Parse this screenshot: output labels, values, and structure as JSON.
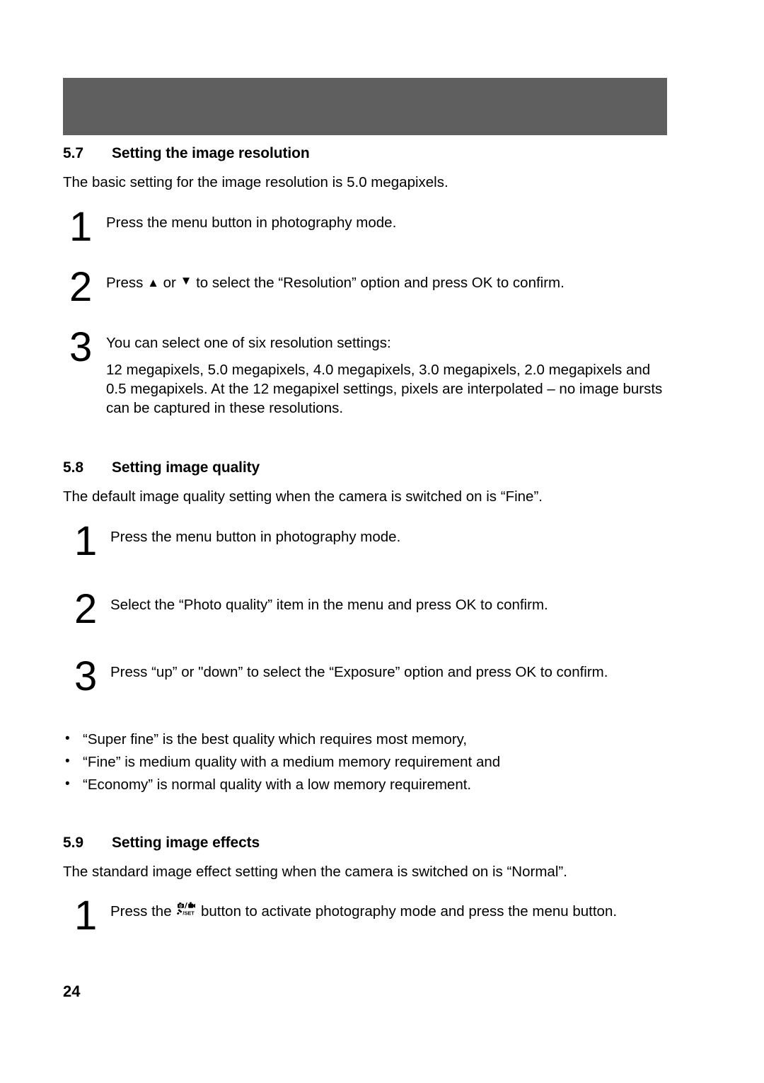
{
  "page": {
    "number": "24",
    "banner_color": "#5f5f5f"
  },
  "sections": [
    {
      "id": "5.7",
      "number": "5.7",
      "title": "Setting the image resolution",
      "intro": "The basic setting for the image resolution is 5.0 megapixels.",
      "steps": [
        {
          "number": "1",
          "lines": [
            "Press the menu button in photography mode."
          ]
        },
        {
          "number": "2",
          "prefix": "Press ",
          "icon_up": "▲",
          "middle": " or ",
          "icon_down": "▼",
          "suffix": " to select the “Resolution” option and press OK to confirm."
        },
        {
          "number": "3",
          "lines": [
            "You can select one of six resolution settings:",
            "12 megapixels, 5.0 megapixels, 4.0 megapixels, 3.0 megapixels, 2.0 megapixels and 0.5 megapixels. At the 12 megapixel settings, pixels are interpolated – no image bursts can be captured in these resolutions."
          ]
        }
      ]
    },
    {
      "id": "5.8",
      "number": "5.8",
      "title": "Setting image quality",
      "intro": "The default image quality setting when the camera is switched on is “Fine”.",
      "steps": [
        {
          "number": "1",
          "lines": [
            "Press the menu button in photography mode."
          ]
        },
        {
          "number": "2",
          "lines": [
            "Select the “Photo quality” item in the menu and press OK to confirm."
          ]
        },
        {
          "number": "3",
          "lines": [
            "Press “up” or \"down” to select the “Exposure” option and press OK to confirm."
          ]
        }
      ],
      "bullets": [
        "“Super fine” is the best quality which requires most memory,",
        "“Fine” is medium quality with a medium memory requirement and",
        "“Economy” is normal quality with a low memory requirement."
      ],
      "bullet_glyph": "•"
    },
    {
      "id": "5.9",
      "number": "5.9",
      "title": "Setting image effects",
      "intro": "The standard image effect setting when the camera is switched on is “Normal”.",
      "steps": [
        {
          "number": "1",
          "prefix": "Press the ",
          "icon_name": "camera-camcorder-set-button-icon",
          "icon_label": "/SET",
          "suffix": " button to activate photography mode and press the menu button."
        }
      ]
    }
  ]
}
